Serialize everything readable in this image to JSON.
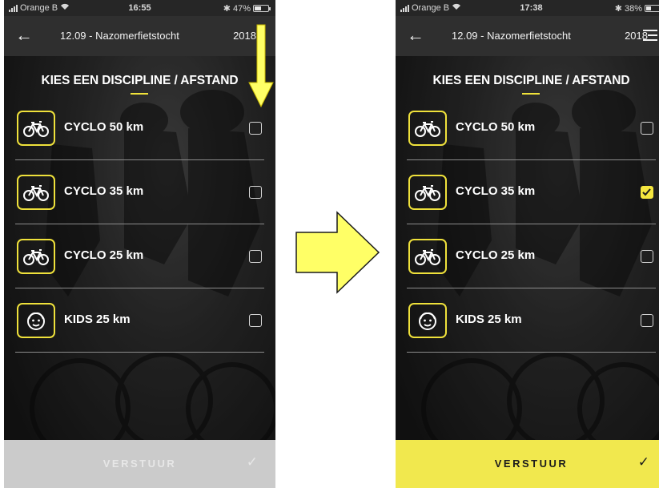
{
  "screens": [
    {
      "status": {
        "carrier": "Orange B",
        "time": "16:55",
        "battery": "47%",
        "battery_level": 0.47
      },
      "nav": {
        "back_icon": "arrow-left-icon",
        "title": "12.09 - Nazomerfietstocht",
        "year": "2018"
      },
      "heading": "KIES EEN DISCIPLINE / AFSTAND",
      "options": [
        {
          "label": "CYCLO 50 km",
          "icon": "bicycle-icon",
          "checked": false
        },
        {
          "label": "CYCLO 35 km",
          "icon": "bicycle-icon",
          "checked": false
        },
        {
          "label": "CYCLO 25 km",
          "icon": "bicycle-icon",
          "checked": false
        },
        {
          "label": "KIDS 25 km",
          "icon": "kid-face-icon",
          "checked": false
        }
      ],
      "submit": {
        "label": "VERSTUUR",
        "check": "✓",
        "enabled": false
      }
    },
    {
      "status": {
        "carrier": "Orange B",
        "time": "17:38",
        "battery": "38%",
        "battery_level": 0.38
      },
      "nav": {
        "back_icon": "arrow-left-icon",
        "title": "12.09 - Nazomerfietstocht",
        "year": "2018",
        "menu_icon": "menu-icon"
      },
      "heading": "KIES EEN DISCIPLINE / AFSTAND",
      "options": [
        {
          "label": "CYCLO 50 km",
          "icon": "bicycle-icon",
          "checked": false
        },
        {
          "label": "CYCLO 35 km",
          "icon": "bicycle-icon",
          "checked": true
        },
        {
          "label": "CYCLO 25 km",
          "icon": "bicycle-icon",
          "checked": false
        },
        {
          "label": "KIDS 25 km",
          "icon": "kid-face-icon",
          "checked": false
        }
      ],
      "submit": {
        "label": "VERSTUUR",
        "check": "✓",
        "enabled": true
      }
    }
  ],
  "annotations": {
    "pointer_arrow": {
      "icon": "down-arrow-icon",
      "color": "#ffff66"
    },
    "transition_arrow": {
      "icon": "right-arrow-icon",
      "color": "#ffff66"
    }
  },
  "colors": {
    "accent": "#f0e23a",
    "submit_enabled": "#f1e84e",
    "submit_disabled": "#cbcbcb"
  }
}
